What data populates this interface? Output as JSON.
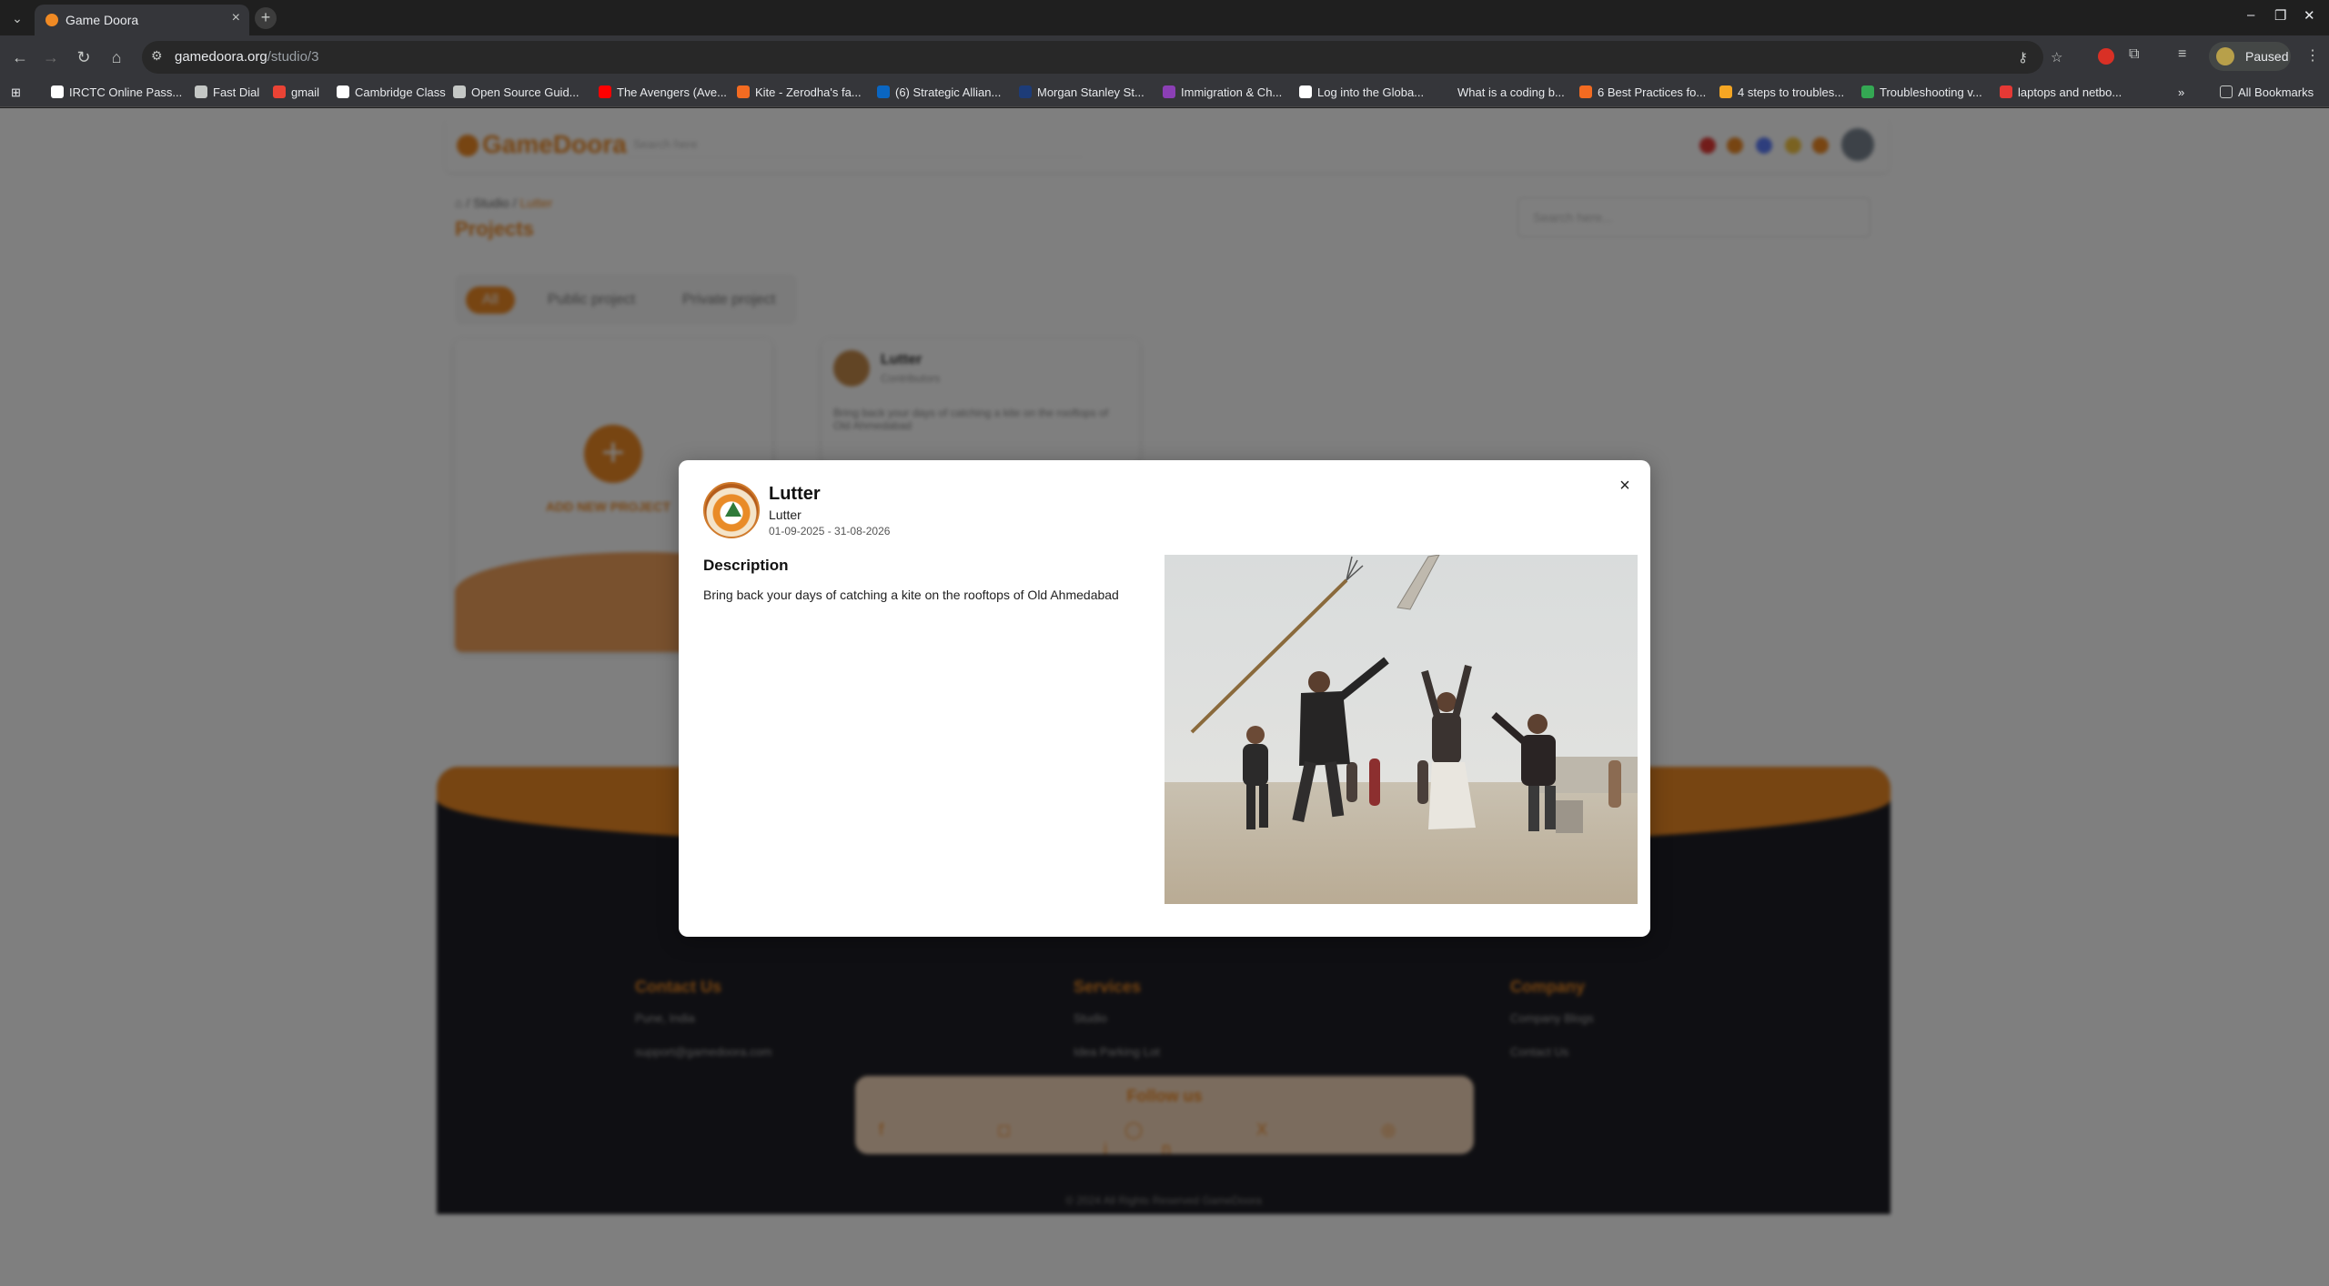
{
  "browser": {
    "tab_title": "Game Doora",
    "new_tab": "+",
    "url_host": "gamedoora.org",
    "url_path": "/studio/3",
    "paused_label": "Paused",
    "bookmarks": [
      {
        "label": "IRCTC Online Pass...",
        "color": "#ffffff"
      },
      {
        "label": "Fast Dial",
        "color": "#c4c7c5"
      },
      {
        "label": "gmail",
        "color": "#ea4335"
      },
      {
        "label": "Cambridge Class",
        "color": "#ffffff"
      },
      {
        "label": "Open Source Guid...",
        "color": "#c4c7c5"
      },
      {
        "label": "The Avengers (Ave...",
        "color": "#ff0000"
      },
      {
        "label": "Kite - Zerodha's fa...",
        "color": "#f36b21"
      },
      {
        "label": "(6) Strategic Allian...",
        "color": "#0a66c2"
      },
      {
        "label": "Morgan Stanley St...",
        "color": "#1d3c78"
      },
      {
        "label": "Immigration & Ch...",
        "color": "#8b3fb5"
      },
      {
        "label": "Log into the Globa...",
        "color": "#ffffff"
      },
      {
        "label": "What is a coding b...",
        "color": "#35363a"
      },
      {
        "label": "6 Best Practices fo...",
        "color": "#f36b21"
      },
      {
        "label": "4 steps to troubles...",
        "color": "#f5a623"
      },
      {
        "label": "Troubleshooting v...",
        "color": "#34a853"
      },
      {
        "label": "laptops and netbo...",
        "color": "#e53935"
      }
    ],
    "all_bookmarks": "All Bookmarks"
  },
  "site": {
    "logo": "GameDoora",
    "search_placeholder": "Search here",
    "breadcrumb": {
      "home": "⌂",
      "sep": "/",
      "studio": "Studio",
      "current": "Lutter"
    },
    "page_title": "Projects",
    "project_search": "Search here...",
    "filters": [
      "All",
      "Public project",
      "Private project"
    ],
    "add_label": "ADD NEW PROJECT",
    "card": {
      "name": "Lutter",
      "sub": "Contributors",
      "desc": "Bring back your days of catching a kite on the rooftops of Old Ahmedabad"
    },
    "footer": {
      "contact_h": "Contact Us",
      "contact_items": [
        "Pune, India",
        "support@gamedoora.com"
      ],
      "services_h": "Services",
      "services_items": [
        "Studio",
        "Idea Parking Lot"
      ],
      "company_h": "Company",
      "company_items": [
        "Company Blogs",
        "Contact Us"
      ],
      "follow_h": "Follow us",
      "social": "f  ◻  ◯  X  ◎  in",
      "copyright": "© 2024 All Rights Reserved GameDoora"
    }
  },
  "modal": {
    "title": "Lutter",
    "subtitle": "Lutter",
    "dates": "01-09-2025 - 31-08-2026",
    "description_heading": "Description",
    "description": "Bring back your days of catching a kite on the rooftops of Old Ahmedabad",
    "close_icon": "×",
    "image_alt": "Boys jumping to catch a kite"
  }
}
